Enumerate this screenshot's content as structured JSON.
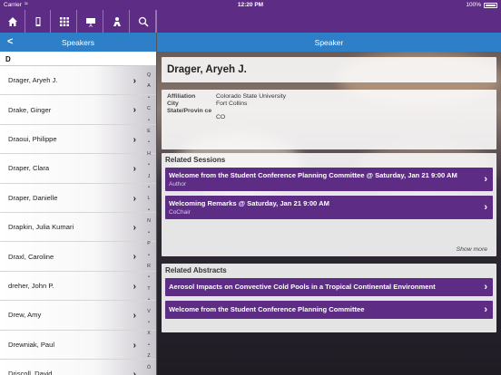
{
  "statusbar": {
    "carrier": "Carrier",
    "time": "12:20 PM",
    "battery": "100%"
  },
  "toolbar": {
    "buttons": [
      {
        "icon": "home-icon"
      },
      {
        "icon": "phone-icon"
      },
      {
        "icon": "grid-icon"
      },
      {
        "icon": "presentation-icon"
      },
      {
        "icon": "person-icon"
      },
      {
        "icon": "search-icon"
      }
    ]
  },
  "nav": {
    "left_title": "Speakers",
    "right_title": "Speaker",
    "back_symbol": "<"
  },
  "list": {
    "section": "D",
    "items": [
      "Drager, Aryeh J.",
      "Drake, Ginger",
      "Draoui, Philippe",
      "Draper, Clara",
      "Draper, Danielle",
      "Drapkin, Julia Kumari",
      "Draxl, Caroline",
      "dreher, John P.",
      "Drew, Amy",
      "Drewniak, Paul",
      "Driscoll, David"
    ],
    "index": [
      "Q",
      "A",
      "•",
      "C",
      "•",
      "E",
      "•",
      "H",
      "•",
      "J",
      "•",
      "L",
      "•",
      "N",
      "•",
      "P",
      "•",
      "R",
      "•",
      "T",
      "•",
      "V",
      "•",
      "X",
      "•",
      "Z",
      "Ö"
    ]
  },
  "speaker": {
    "name": "Drager, Aryeh J.",
    "info": [
      {
        "key": "Affiliation",
        "value": "Colorado State University"
      },
      {
        "key": "City",
        "value": "Fort Collins"
      },
      {
        "key": "State/Provin ce",
        "value": "CO"
      }
    ]
  },
  "sessions": {
    "title": "Related Sessions",
    "items": [
      {
        "main": "Welcome from the Student Conference Planning Committee @ Saturday, Jan 21 9:00 AM",
        "sub": "Author"
      },
      {
        "main": "Welcoming Remarks @ Saturday, Jan 21 9:00 AM",
        "sub": "CoChair"
      }
    ],
    "show_more": "Show more"
  },
  "abstracts": {
    "title": "Related Abstracts",
    "items": [
      {
        "main": "Aerosol Impacts on Convective Cold Pools in a Tropical Continental Environment"
      },
      {
        "main": "Welcome from the Student Conference Planning Committee"
      }
    ]
  },
  "colors": {
    "primary": "#5d2d86",
    "nav_blue": "#2d7fc8"
  }
}
